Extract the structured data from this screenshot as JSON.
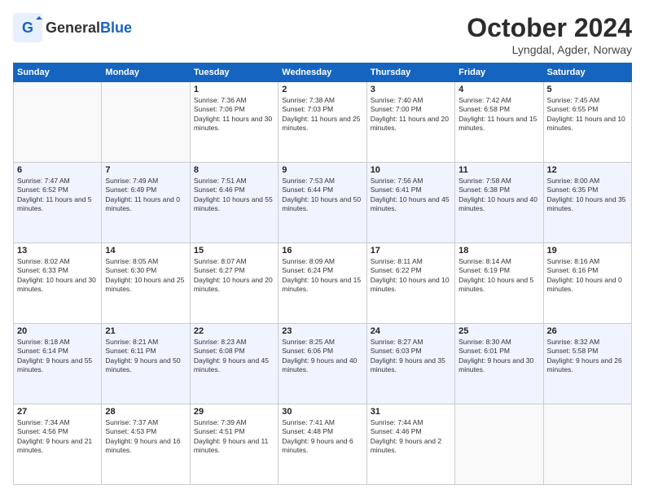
{
  "header": {
    "logo_general": "General",
    "logo_blue": "Blue",
    "month": "October 2024",
    "location": "Lyngdal, Agder, Norway"
  },
  "weekdays": [
    "Sunday",
    "Monday",
    "Tuesday",
    "Wednesday",
    "Thursday",
    "Friday",
    "Saturday"
  ],
  "weeks": [
    [
      {
        "day": "",
        "info": ""
      },
      {
        "day": "",
        "info": ""
      },
      {
        "day": "1",
        "info": "Sunrise: 7:36 AM\nSunset: 7:06 PM\nDaylight: 11 hours and 30 minutes."
      },
      {
        "day": "2",
        "info": "Sunrise: 7:38 AM\nSunset: 7:03 PM\nDaylight: 11 hours and 25 minutes."
      },
      {
        "day": "3",
        "info": "Sunrise: 7:40 AM\nSunset: 7:00 PM\nDaylight: 11 hours and 20 minutes."
      },
      {
        "day": "4",
        "info": "Sunrise: 7:42 AM\nSunset: 6:58 PM\nDaylight: 11 hours and 15 minutes."
      },
      {
        "day": "5",
        "info": "Sunrise: 7:45 AM\nSunset: 6:55 PM\nDaylight: 11 hours and 10 minutes."
      }
    ],
    [
      {
        "day": "6",
        "info": "Sunrise: 7:47 AM\nSunset: 6:52 PM\nDaylight: 11 hours and 5 minutes."
      },
      {
        "day": "7",
        "info": "Sunrise: 7:49 AM\nSunset: 6:49 PM\nDaylight: 11 hours and 0 minutes."
      },
      {
        "day": "8",
        "info": "Sunrise: 7:51 AM\nSunset: 6:46 PM\nDaylight: 10 hours and 55 minutes."
      },
      {
        "day": "9",
        "info": "Sunrise: 7:53 AM\nSunset: 6:44 PM\nDaylight: 10 hours and 50 minutes."
      },
      {
        "day": "10",
        "info": "Sunrise: 7:56 AM\nSunset: 6:41 PM\nDaylight: 10 hours and 45 minutes."
      },
      {
        "day": "11",
        "info": "Sunrise: 7:58 AM\nSunset: 6:38 PM\nDaylight: 10 hours and 40 minutes."
      },
      {
        "day": "12",
        "info": "Sunrise: 8:00 AM\nSunset: 6:35 PM\nDaylight: 10 hours and 35 minutes."
      }
    ],
    [
      {
        "day": "13",
        "info": "Sunrise: 8:02 AM\nSunset: 6:33 PM\nDaylight: 10 hours and 30 minutes."
      },
      {
        "day": "14",
        "info": "Sunrise: 8:05 AM\nSunset: 6:30 PM\nDaylight: 10 hours and 25 minutes."
      },
      {
        "day": "15",
        "info": "Sunrise: 8:07 AM\nSunset: 6:27 PM\nDaylight: 10 hours and 20 minutes."
      },
      {
        "day": "16",
        "info": "Sunrise: 8:09 AM\nSunset: 6:24 PM\nDaylight: 10 hours and 15 minutes."
      },
      {
        "day": "17",
        "info": "Sunrise: 8:11 AM\nSunset: 6:22 PM\nDaylight: 10 hours and 10 minutes."
      },
      {
        "day": "18",
        "info": "Sunrise: 8:14 AM\nSunset: 6:19 PM\nDaylight: 10 hours and 5 minutes."
      },
      {
        "day": "19",
        "info": "Sunrise: 8:16 AM\nSunset: 6:16 PM\nDaylight: 10 hours and 0 minutes."
      }
    ],
    [
      {
        "day": "20",
        "info": "Sunrise: 8:18 AM\nSunset: 6:14 PM\nDaylight: 9 hours and 55 minutes."
      },
      {
        "day": "21",
        "info": "Sunrise: 8:21 AM\nSunset: 6:11 PM\nDaylight: 9 hours and 50 minutes."
      },
      {
        "day": "22",
        "info": "Sunrise: 8:23 AM\nSunset: 6:08 PM\nDaylight: 9 hours and 45 minutes."
      },
      {
        "day": "23",
        "info": "Sunrise: 8:25 AM\nSunset: 6:06 PM\nDaylight: 9 hours and 40 minutes."
      },
      {
        "day": "24",
        "info": "Sunrise: 8:27 AM\nSunset: 6:03 PM\nDaylight: 9 hours and 35 minutes."
      },
      {
        "day": "25",
        "info": "Sunrise: 8:30 AM\nSunset: 6:01 PM\nDaylight: 9 hours and 30 minutes."
      },
      {
        "day": "26",
        "info": "Sunrise: 8:32 AM\nSunset: 5:58 PM\nDaylight: 9 hours and 26 minutes."
      }
    ],
    [
      {
        "day": "27",
        "info": "Sunrise: 7:34 AM\nSunset: 4:56 PM\nDaylight: 9 hours and 21 minutes."
      },
      {
        "day": "28",
        "info": "Sunrise: 7:37 AM\nSunset: 4:53 PM\nDaylight: 9 hours and 16 minutes."
      },
      {
        "day": "29",
        "info": "Sunrise: 7:39 AM\nSunset: 4:51 PM\nDaylight: 9 hours and 11 minutes."
      },
      {
        "day": "30",
        "info": "Sunrise: 7:41 AM\nSunset: 4:48 PM\nDaylight: 9 hours and 6 minutes."
      },
      {
        "day": "31",
        "info": "Sunrise: 7:44 AM\nSunset: 4:46 PM\nDaylight: 9 hours and 2 minutes."
      },
      {
        "day": "",
        "info": ""
      },
      {
        "day": "",
        "info": ""
      }
    ]
  ]
}
